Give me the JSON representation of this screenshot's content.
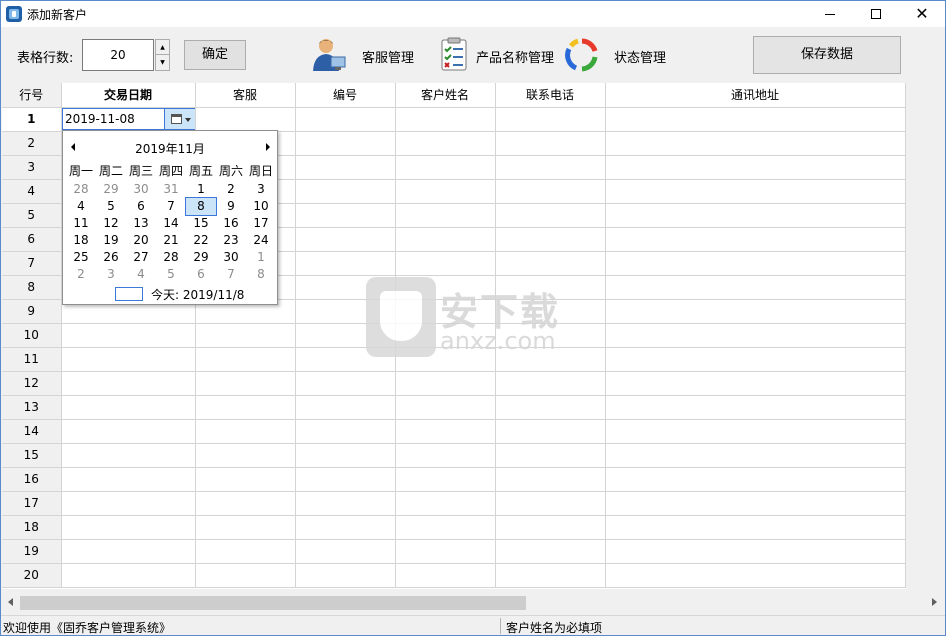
{
  "window": {
    "title": "添加新客户"
  },
  "toolbar": {
    "rows_label": "表格行数:",
    "rows_value": "20",
    "confirm_label": "确定",
    "service_label": "客服管理",
    "product_label": "产品名称管理",
    "status_label": "状态管理",
    "save_label": "保存数据"
  },
  "grid": {
    "columns": [
      "行号",
      "交易日期",
      "客服",
      "编号",
      "客户姓名",
      "联系电话",
      "通讯地址"
    ],
    "row_numbers": [
      "1",
      "2",
      "3",
      "4",
      "5",
      "6",
      "7",
      "8",
      "9",
      "10",
      "11",
      "12",
      "13",
      "14",
      "15",
      "16",
      "17",
      "18",
      "19",
      "20"
    ],
    "active_cell_value": "2019-11-08"
  },
  "calendar": {
    "month_label": "2019年11月",
    "weekdays": [
      "周一",
      "周二",
      "周三",
      "周四",
      "周五",
      "周六",
      "周日"
    ],
    "weeks": [
      [
        "28",
        "29",
        "30",
        "31",
        "1",
        "2",
        "3"
      ],
      [
        "4",
        "5",
        "6",
        "7",
        "8",
        "9",
        "10"
      ],
      [
        "11",
        "12",
        "13",
        "14",
        "15",
        "16",
        "17"
      ],
      [
        "18",
        "19",
        "20",
        "21",
        "22",
        "23",
        "24"
      ],
      [
        "25",
        "26",
        "27",
        "28",
        "29",
        "30",
        "1"
      ],
      [
        "2",
        "3",
        "4",
        "5",
        "6",
        "7",
        "8"
      ]
    ],
    "selected_day": "8",
    "today_label": "今天: 2019/11/8"
  },
  "watermark": {
    "text": "安下载",
    "sub": "anxz.com"
  },
  "statusbar": {
    "left": "欢迎使用《固乔客户管理系统》",
    "right": "客户姓名为必填项"
  }
}
